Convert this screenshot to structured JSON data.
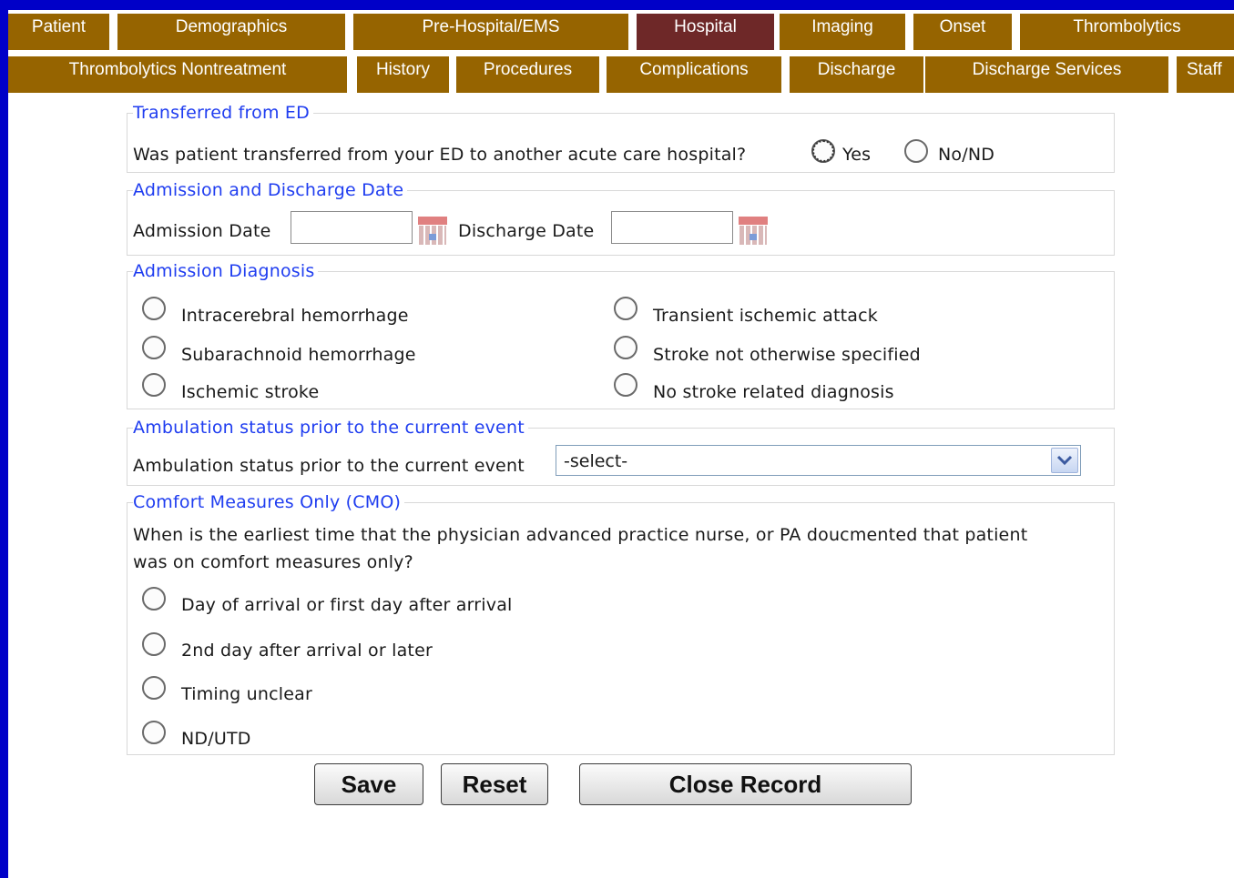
{
  "tabs_row1": [
    {
      "label": "Patient"
    },
    {
      "label": "Demographics"
    },
    {
      "label": "Pre-Hospital/EMS"
    },
    {
      "label": "Hospital",
      "active": true
    },
    {
      "label": "Imaging"
    },
    {
      "label": "Onset"
    },
    {
      "label": "Thrombolytics"
    }
  ],
  "tabs_row2": [
    {
      "label": "Thrombolytics Nontreatment"
    },
    {
      "label": "History"
    },
    {
      "label": "Procedures"
    },
    {
      "label": "Complications"
    },
    {
      "label": "Discharge"
    },
    {
      "label": "Discharge Services"
    },
    {
      "label": "Staff"
    }
  ],
  "transferred": {
    "legend": "Transferred from ED",
    "question": "Was patient transferred from your ED to another acute care hospital?",
    "options": [
      "Yes",
      "No/ND"
    ]
  },
  "dates": {
    "legend": "Admission and Discharge Date",
    "admission_label": "Admission Date",
    "admission_value": "",
    "discharge_label": "Discharge Date",
    "discharge_value": ""
  },
  "diagnosis": {
    "legend": "Admission Diagnosis",
    "options": [
      "Intracerebral hemorrhage",
      "Subarachnoid hemorrhage",
      "Ischemic stroke",
      "Transient ischemic attack",
      "Stroke not otherwise specified",
      "No stroke related diagnosis"
    ]
  },
  "ambulation": {
    "legend": "Ambulation status prior to the current event",
    "label": "Ambulation status prior to the current event",
    "selected": "-select-"
  },
  "cmo": {
    "legend": "Comfort Measures Only (CMO)",
    "question_line1": "When is the earliest time that the physician advanced practice nurse, or PA doucmented that patient",
    "question_line2": "was on comfort measures only?",
    "options": [
      "Day of arrival or first day after arrival",
      "2nd day after arrival or later",
      "Timing unclear",
      "ND/UTD"
    ]
  },
  "buttons": {
    "save": "Save",
    "reset": "Reset",
    "close": "Close Record"
  },
  "colors": {
    "frame": "#0000c8",
    "tab": "#966400",
    "tab_active": "#6e2828",
    "legend": "#1f3df0"
  }
}
